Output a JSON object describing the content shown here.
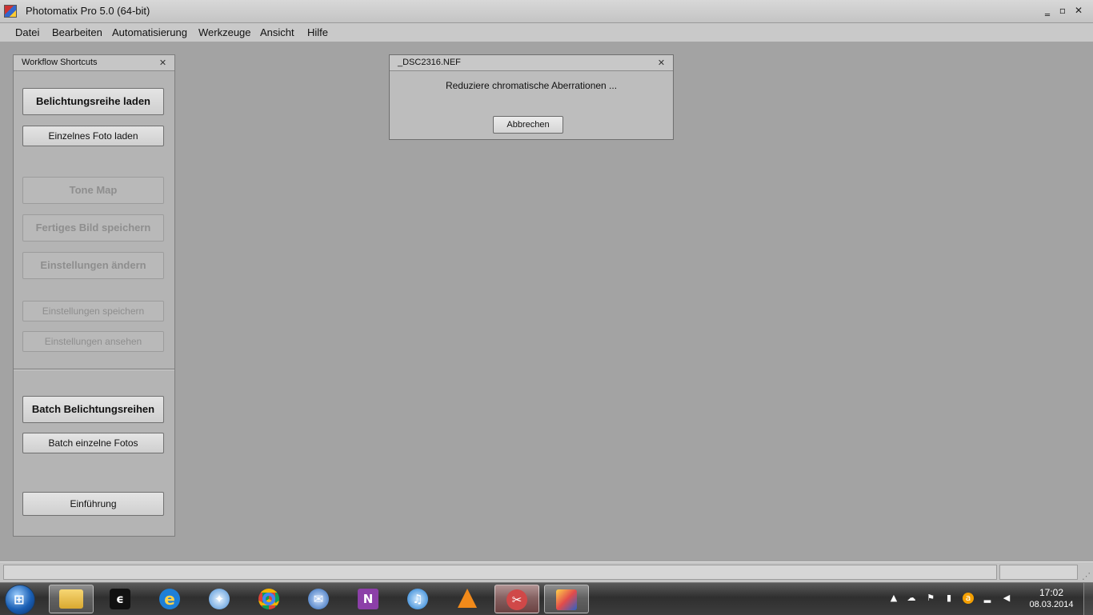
{
  "window": {
    "title": "Photomatix Pro 5.0 (64-bit)",
    "controls": {
      "minimize": "‗",
      "restore": "▫",
      "close": "✕"
    }
  },
  "menu": [
    "Datei",
    "Bearbeiten",
    "Automatisierung",
    "Werkzeuge",
    "Ansicht",
    "Hilfe"
  ],
  "panel": {
    "title": "Workflow Shortcuts",
    "buttons": {
      "load_bracketed": "Belichtungsreihe laden",
      "load_single": "Einzelnes Foto laden",
      "tone_map": "Tone Map",
      "save_final": "Fertiges Bild speichern",
      "change_settings": "Einstellungen ändern",
      "save_settings": "Einstellungen speichern",
      "view_settings": "Einstellungen ansehen",
      "batch_bracketed": "Batch Belichtungsreihen",
      "batch_single": "Batch einzelne Fotos",
      "intro": "Einführung"
    }
  },
  "dialog": {
    "title": "_DSC2316.NEF",
    "message": "Reduziere chromatische Aberrationen ...",
    "cancel": "Abbrechen"
  },
  "taskbar": {
    "clock_time": "17:02",
    "clock_date": "08.03.2014",
    "apps": [
      "file-explorer-icon",
      "app-c-icon",
      "internet-explorer-icon",
      "safari-icon",
      "chrome-icon",
      "thunderbird-icon",
      "onenote-icon",
      "itunes-icon",
      "vlc-icon",
      "photomatix-pinned-icon",
      "photomatix-running-icon"
    ]
  },
  "colors": {
    "workspace": "#a3a3a3",
    "panel": "#b4b4b4",
    "disabled_text": "#8e8e8e"
  }
}
